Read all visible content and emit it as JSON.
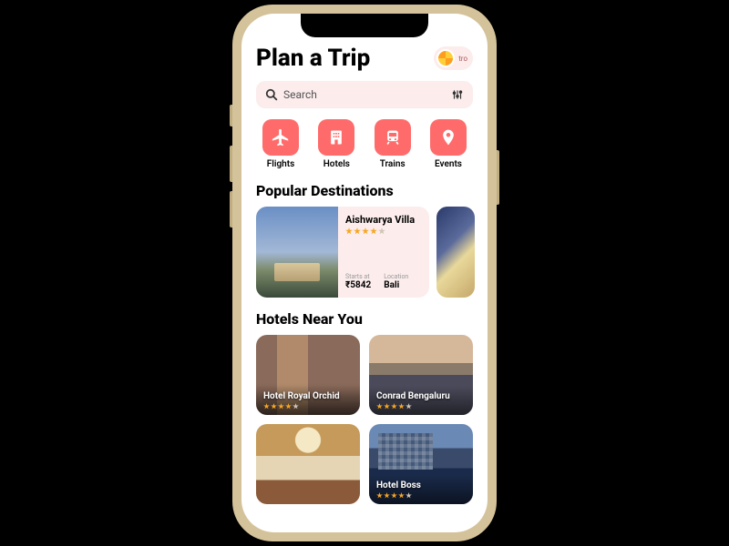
{
  "header": {
    "title": "Plan a Trip",
    "avatar_name": "tro"
  },
  "search": {
    "placeholder": "Search"
  },
  "categories": [
    {
      "label": "Flights",
      "icon": "plane-icon"
    },
    {
      "label": "Hotels",
      "icon": "building-icon"
    },
    {
      "label": "Trains",
      "icon": "train-icon"
    },
    {
      "label": "Events",
      "icon": "pin-icon"
    }
  ],
  "sections": {
    "popular_title": "Popular Destinations",
    "near_title": "Hotels Near You"
  },
  "popular": [
    {
      "name": "Aishwarya Villa",
      "rating": 4,
      "price_label": "Starts at",
      "price": "₹5842",
      "location_label": "Location",
      "location": "Bali"
    }
  ],
  "hotels_near": [
    {
      "name": "Hotel Royal Orchid",
      "rating": 4
    },
    {
      "name": "Conrad Bengaluru",
      "rating": 4
    },
    {
      "name": "",
      "rating": 0
    },
    {
      "name": "Hotel Boss",
      "rating": 4
    }
  ],
  "colors": {
    "accent": "#ff6b6b",
    "soft": "#fcecec",
    "star": "#f5a623"
  }
}
